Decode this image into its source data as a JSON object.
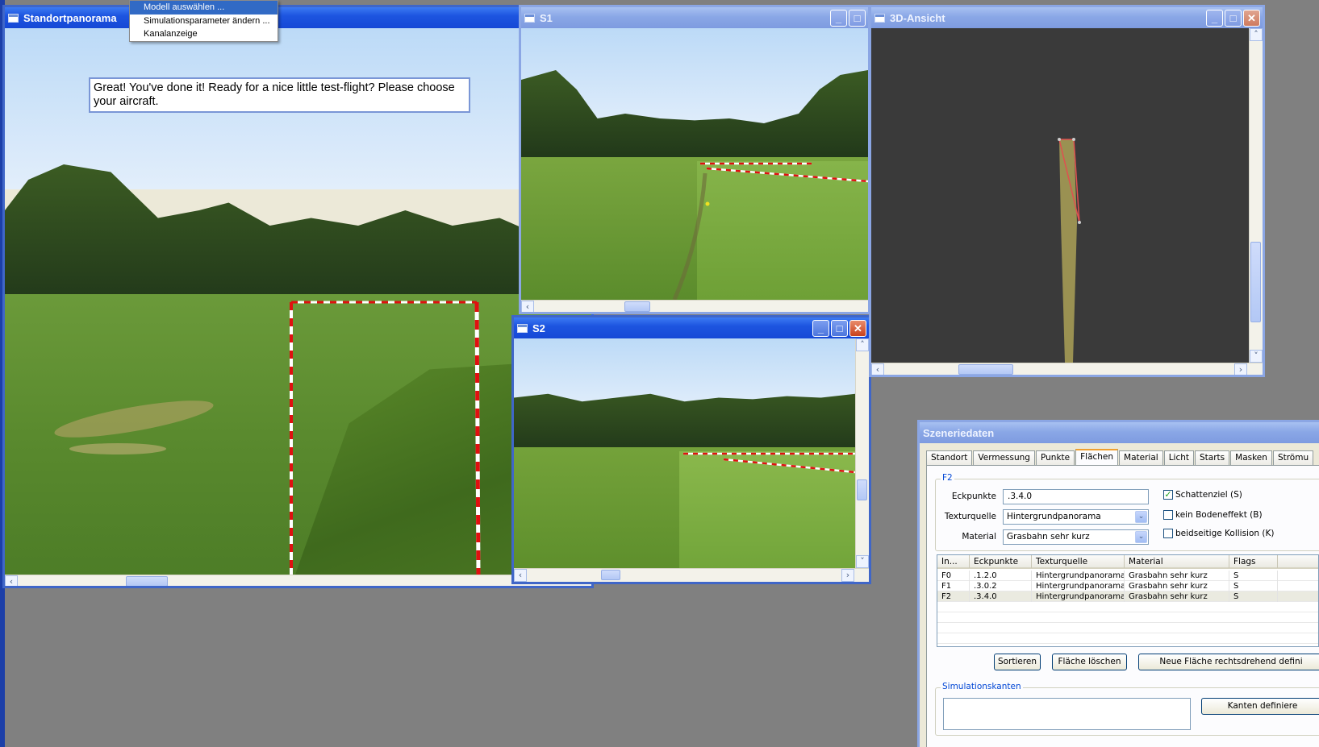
{
  "menu": {
    "items": [
      {
        "label": "Modell auswählen ..."
      },
      {
        "label": "Simulationsparameter ändern ..."
      },
      {
        "label": "Kanalanzeige"
      }
    ]
  },
  "windows": {
    "panorama": {
      "title": "Standortpanorama",
      "message": "Great! You've done it! Ready for a nice little test-flight? Please choose your aircraft."
    },
    "s1": {
      "title": "S1"
    },
    "s2": {
      "title": "S2"
    },
    "view3d": {
      "title": "3D-Ansicht"
    }
  },
  "window_buttons": {
    "minimize": "_",
    "maximize": "□",
    "close": "✕"
  },
  "scroll_glyphs": {
    "left": "‹",
    "right": "›",
    "up": "˄",
    "down": "˅"
  },
  "scene": {
    "panel_title": "Szeneriedaten",
    "tabs": [
      "Standort",
      "Vermessung",
      "Punkte",
      "Flächen",
      "Material",
      "Licht",
      "Starts",
      "Masken",
      "Strömu"
    ],
    "selected_tab": "Flächen",
    "face_group": {
      "legend": "F2",
      "eckpunkte_label": "Eckpunkte",
      "eckpunkte_value": ".3.4.0",
      "texturquelle_label": "Texturquelle",
      "texturquelle_value": "Hintergrundpanorama",
      "material_label": "Material",
      "material_value": "Grasbahn sehr kurz",
      "checkboxes": [
        {
          "label": "Schattenziel (S)",
          "checked": true
        },
        {
          "label": "kein Bodeneffekt (B)",
          "checked": false
        },
        {
          "label": "beidseitige Kollision (K)",
          "checked": false
        }
      ]
    },
    "table": {
      "columns": [
        "In...",
        "Eckpunkte",
        "Texturquelle",
        "Material",
        "Flags"
      ],
      "rows": [
        [
          "F0",
          ".1.2.0",
          "Hintergrundpanorama",
          "Grasbahn sehr kurz",
          "S"
        ],
        [
          "F1",
          ".3.0.2",
          "Hintergrundpanorama",
          "Grasbahn sehr kurz",
          "S"
        ],
        [
          "F2",
          ".3.4.0",
          "Hintergrundpanorama",
          "Grasbahn sehr kurz",
          "S"
        ]
      ]
    },
    "buttons": {
      "sort": "Sortieren",
      "delete": "Fläche löschen",
      "new_face": "Neue Fläche rechtsdrehend defini"
    },
    "edges_group": {
      "legend": "Simulationskanten",
      "define_button": "Kanten definiere"
    }
  },
  "icons": {
    "checkmark": "✓",
    "combo-arrow": "⌄"
  }
}
